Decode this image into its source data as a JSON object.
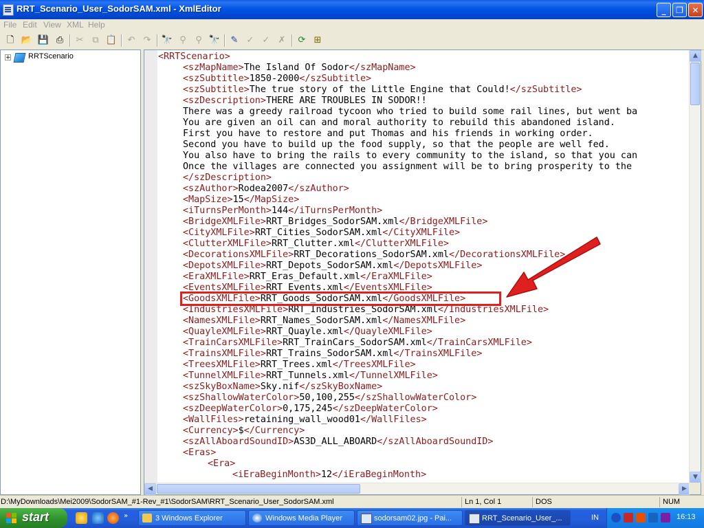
{
  "window": {
    "title": "RRT_Scenario_User_SodorSAM.xml - XmlEditor",
    "minimize": "_",
    "restore": "❐",
    "close": "✕"
  },
  "menu": [
    "File",
    "Edit",
    "View",
    "XML",
    "Help"
  ],
  "tree": {
    "expander": "+",
    "root": "RRTScenario"
  },
  "code_lines": [
    {
      "indent": 0,
      "parts": [
        [
          "tag",
          "<RRTScenario>"
        ]
      ]
    },
    {
      "indent": 1,
      "parts": [
        [
          "tag",
          "<szMapName>"
        ],
        [
          "txt",
          "The Island Of Sodor"
        ],
        [
          "tag",
          "</szMapName>"
        ]
      ]
    },
    {
      "indent": 1,
      "parts": [
        [
          "tag",
          "<szSubtitle>"
        ],
        [
          "txt",
          "1850-2000"
        ],
        [
          "tag",
          "</szSubtitle>"
        ]
      ]
    },
    {
      "indent": 1,
      "parts": [
        [
          "tag",
          "<szSubtitle>"
        ],
        [
          "txt",
          "The true story of the Little Engine that Could!"
        ],
        [
          "tag",
          "</szSubtitle>"
        ]
      ]
    },
    {
      "indent": 1,
      "parts": [
        [
          "tag",
          "<szDescription>"
        ],
        [
          "txt",
          "THERE ARE TROUBLES IN SODOR!!"
        ]
      ]
    },
    {
      "indent": 1,
      "parts": [
        [
          "txt",
          "There was a greedy railroad tycoon who tried to build some rail lines, but went ba"
        ]
      ]
    },
    {
      "indent": 1,
      "parts": [
        [
          "txt",
          "You are given an oil can and moral authority to rebuild this abandoned island."
        ]
      ]
    },
    {
      "indent": 1,
      "parts": [
        [
          "txt",
          "First you have to restore and put Thomas and his friends in working order."
        ]
      ]
    },
    {
      "indent": 1,
      "parts": [
        [
          "txt",
          "Second you have to build up the food supply, so that the people are well fed."
        ]
      ]
    },
    {
      "indent": 1,
      "parts": [
        [
          "txt",
          "You also have to bring the rails to every community to the island, so that you can"
        ]
      ]
    },
    {
      "indent": 1,
      "parts": [
        [
          "txt",
          "Once the villages are connected you assignment will be to bring prosperity to the"
        ]
      ]
    },
    {
      "indent": 1,
      "parts": [
        [
          "tag",
          "</szDescription>"
        ]
      ]
    },
    {
      "indent": 1,
      "parts": [
        [
          "tag",
          "<szAuthor>"
        ],
        [
          "txt",
          "Rodea2007"
        ],
        [
          "tag",
          "</szAuthor>"
        ]
      ]
    },
    {
      "indent": 1,
      "parts": [
        [
          "tag",
          "<MapSize>"
        ],
        [
          "txt",
          "15"
        ],
        [
          "tag",
          "</MapSize>"
        ]
      ]
    },
    {
      "indent": 1,
      "parts": [
        [
          "tag",
          "<iTurnsPerMonth>"
        ],
        [
          "txt",
          "144"
        ],
        [
          "tag",
          "</iTurnsPerMonth>"
        ]
      ]
    },
    {
      "indent": 1,
      "parts": [
        [
          "tag",
          "<BridgeXMLFile>"
        ],
        [
          "txt",
          "RRT_Bridges_SodorSAM.xml"
        ],
        [
          "tag",
          "</BridgeXMLFile>"
        ]
      ]
    },
    {
      "indent": 1,
      "parts": [
        [
          "tag",
          "<CityXMLFile>"
        ],
        [
          "txt",
          "RRT_Cities_SodorSAM.xml"
        ],
        [
          "tag",
          "</CityXMLFile>"
        ]
      ]
    },
    {
      "indent": 1,
      "parts": [
        [
          "tag",
          "<ClutterXMLFile>"
        ],
        [
          "txt",
          "RRT_Clutter.xml"
        ],
        [
          "tag",
          "</ClutterXMLFile>"
        ]
      ]
    },
    {
      "indent": 1,
      "parts": [
        [
          "tag",
          "<DecorationsXMLFile>"
        ],
        [
          "txt",
          "RRT_Decorations_SodorSAM.xml"
        ],
        [
          "tag",
          "</DecorationsXMLFile>"
        ]
      ]
    },
    {
      "indent": 1,
      "parts": [
        [
          "tag",
          "<DepotsXMLFile>"
        ],
        [
          "txt",
          "RRT_Depots_SodorSAM.xml"
        ],
        [
          "tag",
          "</DepotsXMLFile>"
        ]
      ]
    },
    {
      "indent": 1,
      "parts": [
        [
          "tag",
          "<EraXMLFile>"
        ],
        [
          "txt",
          "RRT_Eras_Default.xml"
        ],
        [
          "tag",
          "</EraXMLFile>"
        ]
      ]
    },
    {
      "indent": 1,
      "parts": [
        [
          "tag",
          "<EventsXMLFile>"
        ],
        [
          "txt",
          "RRT_Events.xml"
        ],
        [
          "tag",
          "</EventsXMLFile>"
        ]
      ]
    },
    {
      "indent": 1,
      "parts": [
        [
          "tag",
          "<GoodsXMLFile>"
        ],
        [
          "txt",
          "RRT_Goods_SodorSAM.xml"
        ],
        [
          "tag",
          "</GoodsXMLFile>"
        ]
      ]
    },
    {
      "indent": 1,
      "parts": [
        [
          "tag",
          "<IndustriesXMLFile>"
        ],
        [
          "txt",
          "RRT_Industries_SodorSAM.xml"
        ],
        [
          "tag",
          "</IndustriesXMLFile>"
        ]
      ]
    },
    {
      "indent": 1,
      "parts": [
        [
          "tag",
          "<NamesXMLFile>"
        ],
        [
          "txt",
          "RRT_Names_SodorSAM.xml"
        ],
        [
          "tag",
          "</NamesXMLFile>"
        ]
      ]
    },
    {
      "indent": 1,
      "parts": [
        [
          "tag",
          "<QuayleXMLFile>"
        ],
        [
          "txt",
          "RRT_Quayle.xml"
        ],
        [
          "tag",
          "</QuayleXMLFile>"
        ]
      ]
    },
    {
      "indent": 1,
      "parts": [
        [
          "tag",
          "<TrainCarsXMLFile>"
        ],
        [
          "txt",
          "RRT_TrainCars_SodorSAM.xml"
        ],
        [
          "tag",
          "</TrainCarsXMLFile>"
        ]
      ]
    },
    {
      "indent": 1,
      "parts": [
        [
          "tag",
          "<TrainsXMLFile>"
        ],
        [
          "txt",
          "RRT_Trains_SodorSAM.xml"
        ],
        [
          "tag",
          "</TrainsXMLFile>"
        ]
      ]
    },
    {
      "indent": 1,
      "parts": [
        [
          "tag",
          "<TreesXMLFile>"
        ],
        [
          "txt",
          "RRT_Trees.xml"
        ],
        [
          "tag",
          "</TreesXMLFile>"
        ]
      ]
    },
    {
      "indent": 1,
      "parts": [
        [
          "tag",
          "<TunnelXMLFile>"
        ],
        [
          "txt",
          "RRT_Tunnels.xml"
        ],
        [
          "tag",
          "</TunnelXMLFile>"
        ]
      ]
    },
    {
      "indent": 1,
      "parts": [
        [
          "tag",
          "<szSkyBoxName>"
        ],
        [
          "txt",
          "Sky.nif"
        ],
        [
          "tag",
          "</szSkyBoxName>"
        ]
      ]
    },
    {
      "indent": 1,
      "parts": [
        [
          "tag",
          "<szShallowWaterColor>"
        ],
        [
          "txt",
          "50,100,255"
        ],
        [
          "tag",
          "</szShallowWaterColor>"
        ]
      ]
    },
    {
      "indent": 1,
      "parts": [
        [
          "tag",
          "<szDeepWaterColor>"
        ],
        [
          "txt",
          "0,175,245"
        ],
        [
          "tag",
          "</szDeepWaterColor>"
        ]
      ]
    },
    {
      "indent": 1,
      "parts": [
        [
          "tag",
          "<WallFiles>"
        ],
        [
          "txt",
          "retaining_wall_wood01"
        ],
        [
          "tag",
          "</WallFiles>"
        ]
      ]
    },
    {
      "indent": 1,
      "parts": [
        [
          "tag",
          "<Currency>"
        ],
        [
          "txt",
          "$"
        ],
        [
          "tag",
          "</Currency>"
        ]
      ]
    },
    {
      "indent": 1,
      "parts": [
        [
          "tag",
          "<szAllAboardSoundID>"
        ],
        [
          "txt",
          "AS3D_ALL_ABOARD"
        ],
        [
          "tag",
          "</szAllAboardSoundID>"
        ]
      ]
    },
    {
      "indent": 1,
      "parts": [
        [
          "tag",
          "<Eras>"
        ]
      ]
    },
    {
      "indent": 2,
      "parts": [
        [
          "tag",
          "<Era>"
        ]
      ]
    },
    {
      "indent": 3,
      "parts": [
        [
          "tag",
          "<iEraBeginMonth>"
        ],
        [
          "txt",
          "12"
        ],
        [
          "tag",
          "</iEraBeginMonth>"
        ]
      ]
    }
  ],
  "status": {
    "path": "D:\\MyDownloads\\Mei2009\\SodorSAM_#1-Rev_#1\\SodorSAM\\RRT_Scenario_User_SodorSAM.xml",
    "position": "Ln 1, Col 1",
    "line_endings": "DOS",
    "num": "NUM"
  },
  "taskbar": {
    "start": "start",
    "tasks": [
      {
        "label": "3 Windows Explorer"
      },
      {
        "label": "Windows Media Player"
      },
      {
        "label": "sodorsam02.jpg - Pai..."
      },
      {
        "label": "RRT_Scenario_User_..."
      }
    ],
    "lang": "IN",
    "clock": "16:13"
  },
  "colors": {
    "tag": "#8b1a1a",
    "text": "#000000",
    "highlight_box": "#e01f1f",
    "arrow": "#e01f1f"
  }
}
